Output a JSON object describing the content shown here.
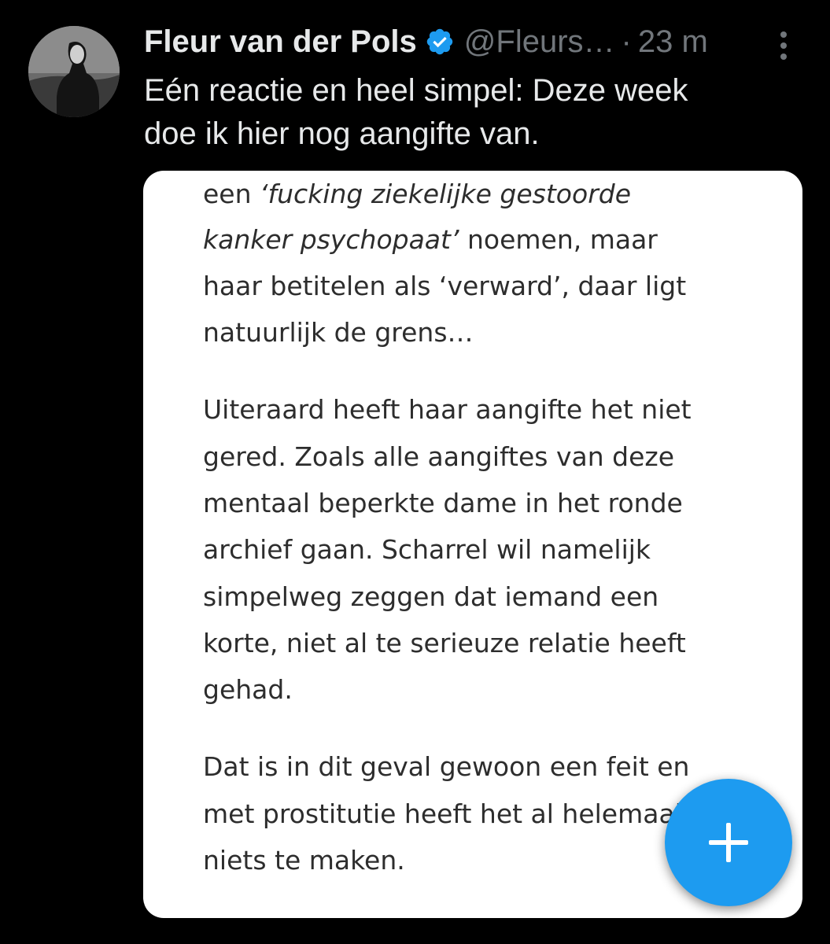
{
  "tweet": {
    "display_name": "Fleur van der Pols",
    "handle": "@Fleurs…",
    "separator": "·",
    "time": "23 m",
    "text_lines": [
      "Eén reactie en heel simpel: Deze week",
      "doe ik hier nog aangifte van."
    ]
  },
  "media": {
    "lines": [
      {
        "pre": "een ",
        "em": "‘fucking ziekelijke gestoorde",
        "post": ""
      },
      {
        "pre": "",
        "em": "kanker psychopaat’",
        "post": " noemen, maar"
      },
      {
        "pre": "haar betitelen als ‘verward’, daar ligt",
        "em": "",
        "post": ""
      },
      {
        "pre": "natuurlijk de grens…",
        "em": "",
        "post": ""
      },
      {
        "pre": "Uiteraard heeft haar aangifte het niet",
        "em": "",
        "post": ""
      },
      {
        "pre": "gered. Zoals alle aangiftes van deze",
        "em": "",
        "post": ""
      },
      {
        "pre": "mentaal beperkte dame in het ronde",
        "em": "",
        "post": ""
      },
      {
        "pre": "archief gaan. Scharrel wil namelijk",
        "em": "",
        "post": ""
      },
      {
        "pre": "simpelweg zeggen dat iemand een",
        "em": "",
        "post": ""
      },
      {
        "pre": "korte, niet al te serieuze relatie heeft",
        "em": "",
        "post": ""
      },
      {
        "pre": "gehad.",
        "em": "",
        "post": ""
      },
      {
        "pre": "Dat is in dit geval gewoon een feit en",
        "em": "",
        "post": ""
      },
      {
        "pre": "met prostitutie heeft het al helemaal",
        "em": "",
        "post": ""
      },
      {
        "pre": "niets te maken.",
        "em": "",
        "post": ""
      }
    ]
  },
  "icons": {
    "verified": "verified-badge-icon",
    "more": "more-vertical-icon",
    "compose": "plus-icon"
  },
  "colors": {
    "background": "#000000",
    "primary_text": "#e7e9ea",
    "secondary_text": "#71767b",
    "accent": "#1d9bf0",
    "media_text": "#2d2d2d"
  }
}
